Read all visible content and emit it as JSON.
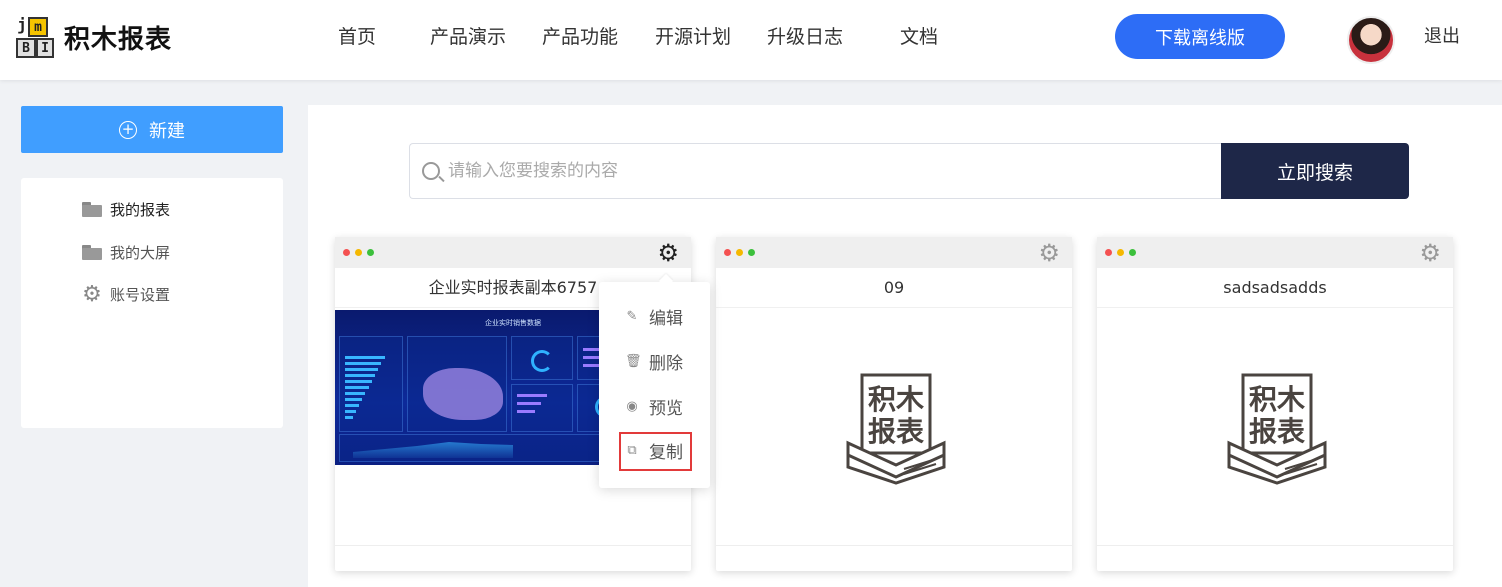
{
  "header": {
    "logo_text": "积木报表",
    "logo_letters": [
      "j",
      "m",
      "B",
      "I"
    ],
    "nav": [
      "首页",
      "产品演示",
      "产品功能",
      "开源计划",
      "升级日志",
      "文档"
    ],
    "download_label": "下载离线版",
    "logout_label": "退出",
    "accent_color": "#2d6df6"
  },
  "sidebar": {
    "new_label": "新建",
    "items": [
      {
        "label": "我的报表",
        "icon": "folder-icon",
        "active": true
      },
      {
        "label": "我的大屏",
        "icon": "folder-icon",
        "active": false
      },
      {
        "label": "账号设置",
        "icon": "gear-icon",
        "active": false
      }
    ]
  },
  "search": {
    "placeholder": "请输入您要搜索的内容",
    "button_label": "立即搜索"
  },
  "cards": [
    {
      "title": "企业实时报表副本6757",
      "thumbnail_title": "企业实时销售数据"
    },
    {
      "title": "09"
    },
    {
      "title": "sadsadsadds"
    }
  ],
  "placeholder_logo": {
    "line1": "积木",
    "line2": "报表"
  },
  "context_menu": {
    "items": [
      "编辑",
      "删除",
      "预览",
      "复制"
    ],
    "highlighted": "复制"
  }
}
